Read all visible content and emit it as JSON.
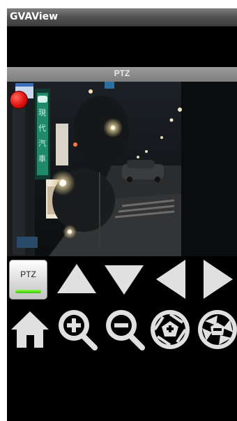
{
  "app": {
    "title": "GVAView"
  },
  "view": {
    "mode_label": "PTZ"
  },
  "controls": {
    "ptz_toggle_label": "PTZ",
    "ptz_active": true
  },
  "colors": {
    "accent_green": "#37c300",
    "record_red": "#e01010",
    "icon_fill": "#e0e0e0"
  },
  "icons": [
    "record-indicator-icon",
    "arrow-up-icon",
    "arrow-down-icon",
    "arrow-left-icon",
    "arrow-right-icon",
    "home-icon",
    "zoom-in-icon",
    "zoom-out-icon",
    "iris-open-icon",
    "iris-close-icon"
  ]
}
